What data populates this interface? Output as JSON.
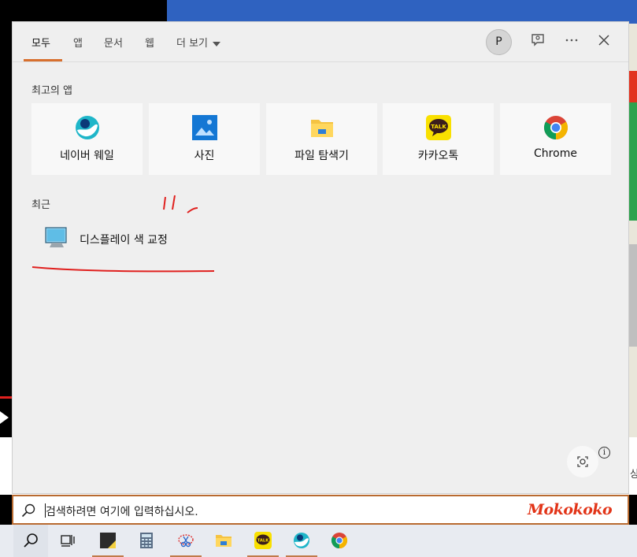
{
  "tabs": [
    {
      "label": "모두",
      "active": true
    },
    {
      "label": "앱"
    },
    {
      "label": "문서"
    },
    {
      "label": "웹"
    },
    {
      "label": "더 보기"
    }
  ],
  "header": {
    "avatar_letter": "P",
    "icons": [
      "feedback-icon",
      "more-icon",
      "close-icon"
    ]
  },
  "top_apps": {
    "label": "최고의 앱",
    "items": [
      {
        "label": "네이버 웨일",
        "icon": "whale-icon"
      },
      {
        "label": "사진",
        "icon": "photos-icon"
      },
      {
        "label": "파일 탐색기",
        "icon": "file-explorer-icon"
      },
      {
        "label": "카카오톡",
        "icon": "kakaotalk-icon"
      },
      {
        "label": "Chrome",
        "icon": "chrome-icon"
      }
    ]
  },
  "recent": {
    "label": "최근",
    "items": [
      {
        "label": "디스플레이 색 교정",
        "icon": "display-icon"
      }
    ]
  },
  "search": {
    "placeholder": "검색하려면 여기에 입력하십시오.",
    "watermark": "Mokokoko"
  },
  "taskbar": {
    "items": [
      "search-icon",
      "task-view-icon",
      "sticky-notes-icon",
      "calculator-icon",
      "snipping-tool-icon",
      "file-explorer-icon",
      "kakaotalk-icon",
      "whale-icon",
      "chrome-icon"
    ]
  },
  "background": {
    "right_edge_text": "상"
  },
  "colors": {
    "accent": "#d8702e",
    "panel_bg": "#efefef",
    "annotation_red": "#e0201e"
  }
}
